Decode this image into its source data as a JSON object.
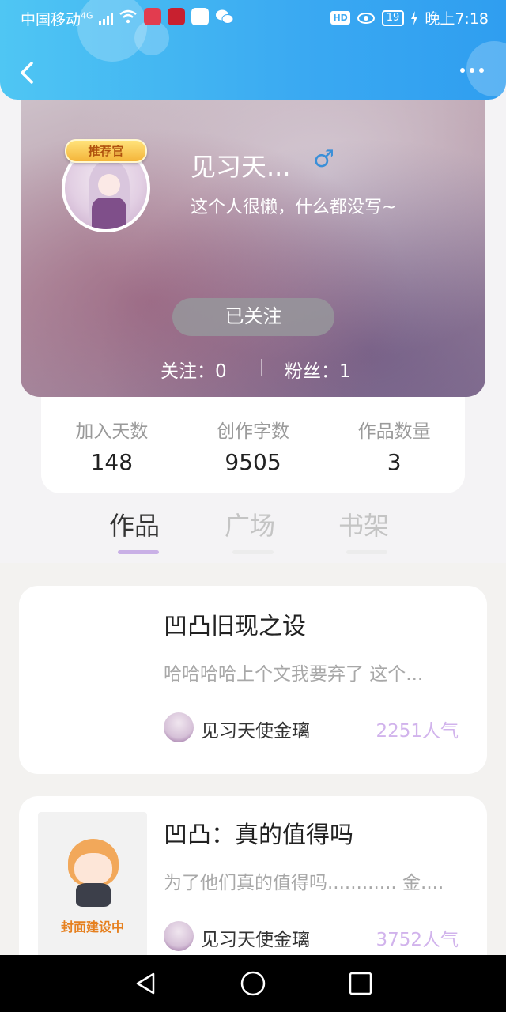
{
  "status_bar": {
    "carrier": "中国移动",
    "network": "4G",
    "battery": "19",
    "time": "晚上7:18"
  },
  "profile": {
    "badge": "推荐官",
    "username": "见习天...",
    "gender_symbol": "♂",
    "bio": "这个人很懒，什么都没写~",
    "follow_button": "已关注",
    "following_label": "关注：0",
    "followers_label": "粉丝：1"
  },
  "stats": [
    {
      "label": "加入天数",
      "value": "148"
    },
    {
      "label": "创作字数",
      "value": "9505"
    },
    {
      "label": "作品数量",
      "value": "3"
    }
  ],
  "tabs": [
    {
      "label": "作品",
      "active": true
    },
    {
      "label": "广场",
      "active": false
    },
    {
      "label": "书架",
      "active": false
    }
  ],
  "works": [
    {
      "title": "凹凸旧现之设",
      "description": "哈哈哈哈上个文我要弃了 这个...",
      "author": "见习天使金璃",
      "popularity": "2251人气"
    },
    {
      "title": "凹凸：真的值得吗",
      "description": "为了他们真的值得吗............ 金....",
      "author": "见习天使金璃",
      "popularity": "3752人气",
      "cover_text": "封面建设中"
    }
  ],
  "colors": {
    "header_blue": "#3aa9f2",
    "accent_purple": "#c9b0e6",
    "popularity_purple": "#d1b3ec"
  }
}
